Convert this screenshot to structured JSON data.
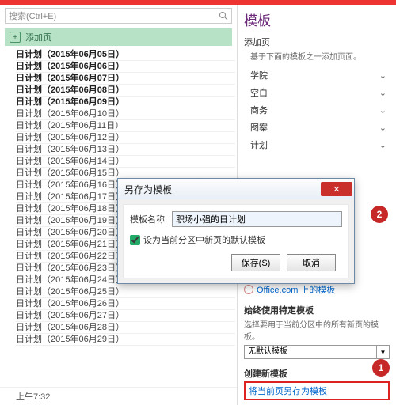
{
  "search": {
    "placeholder": "搜索(Ctrl+E)"
  },
  "addpage": {
    "label": "添加页"
  },
  "pages": {
    "bold": [
      "日计划（2015年06月05日）",
      "日计划（2015年06月06日）",
      "日计划（2015年06月07日）",
      "日计划（2015年06月08日）",
      "日计划（2015年06月09日）"
    ],
    "normal": [
      "日计划（2015年06月10日）",
      "日计划（2015年06月11日）",
      "日计划（2015年06月12日）",
      "日计划（2015年06月13日）",
      "日计划（2015年06月14日）",
      "日计划（2015年06月15日）",
      "日计划（2015年06月16日）",
      "日计划（2015年06月17日）",
      "日计划（2015年06月18日）",
      "日计划（2015年06月19日）",
      "日计划（2015年06月20日）",
      "日计划（2015年06月21日）",
      "日计划（2015年06月22日）",
      "日计划（2015年06月23日）",
      "日计划（2015年06月24日）",
      "日计划（2015年06月25日）",
      "日计划（2015年06月26日）",
      "日计划（2015年06月27日）",
      "日计划（2015年06月28日）",
      "日计划（2015年06月29日）"
    ]
  },
  "footer": {
    "time": "上午7:32"
  },
  "panel": {
    "title": "模板",
    "addpage": "添加页",
    "desc": "基于下面的模板之一添加页面。",
    "cats": [
      "学院",
      "空白",
      "商务",
      "图案",
      "计划"
    ],
    "office_link": "Office.com 上的模板",
    "always_h": "始终使用特定模板",
    "always_hint": "选择要用于当前分区中的所有新页的模板。",
    "combo_value": "无默认模板",
    "create_h": "创建新模板",
    "create_link": "将当前页另存为模板"
  },
  "dialog": {
    "title": "另存为模板",
    "name_label": "模板名称:",
    "name_value": "职场小强的日计划",
    "checkbox_label": "设为当前分区中新页的默认模板",
    "save": "保存(S)",
    "cancel": "取消"
  },
  "callouts": {
    "one": "1",
    "two": "2"
  }
}
